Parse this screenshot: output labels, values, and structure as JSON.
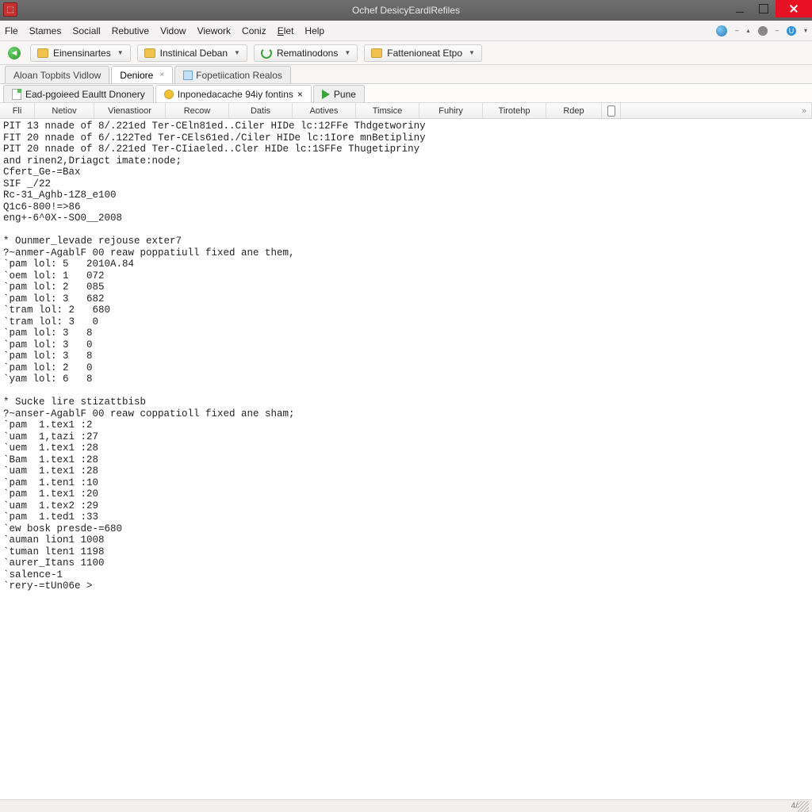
{
  "window": {
    "title": "Ochef DesicyEardlRefiles"
  },
  "menus": [
    "Fle",
    "Stames",
    "Sociall",
    "Rebutive",
    "Vidow",
    "Viework",
    "Coniz",
    "Elet",
    "Help"
  ],
  "menu_underline_idx": [
    -1,
    -1,
    -1,
    -1,
    -1,
    -1,
    -1,
    0,
    -1
  ],
  "toolbar": {
    "b1": "Einensinartes",
    "b2": "Instinical Deban",
    "b3": "Rematinodons",
    "b4": "Fattenioneat Etpo"
  },
  "filetabs": {
    "t1": "Aloan Topbits Vidlow",
    "t2": "Deniore",
    "t3": "Fopetiication Realos"
  },
  "subtabs": {
    "s1": "Ead-pgoieed Eaultt Dnonery",
    "s2": "Inponedacache 94iy fontins",
    "s3": "Pune"
  },
  "cols": {
    "c1": "Fli",
    "c2": "Netiov",
    "c3": "Vienastioor",
    "c4": "Recow",
    "c5": "Datis",
    "c6": "Aotives",
    "c7": "Timsice",
    "c8": "Fuhiry",
    "c9": "Tirotehp",
    "c10": "Rdep"
  },
  "output": "PIT 13 nnade of 8/.221ed Ter-CEln81ed..Ciler HIDe lc:12FFe Thdgetworiny\nFIT 20 nnade of 6/.122Ted Ter-CEls61ed./Ciler HIDe lc:1Iore mnBetipliny\nPIT 20 nnade of 8/.221ed Ter-CIiaeled..Cler HIDe lc:1SFFe Thugetipriny\nand rinen2,Driagct imate:node;\nCfert_Ge-=Bax\nSIF _/22\nRc-31_Aghb-1Z8_e100\nQ1c6-800!=>86\neng+-6^0X--SO0__2008\n\n* Ounmer_levade rejouse exter7\n?~anmer-AgablF 00 reaw poppatiull fixed ane them,\n`pam lol: 5   2010A.84\n`oem lol: 1   072\n`pam lol: 2   085\n`pam lol: 3   682\n`tram lol: 2   680\n`tram lol: 3   0\n`pam lol: 3   8\n`pam lol: 3   0\n`pam lol: 3   8\n`pam lol: 2   0\n`yam lol: 6   8\n\n* Sucke lire stizattbisb\n?~anser-AgablF 00 reaw coppatioll fixed ane sham;\n`pam  1.tex1 :2\n`uam  1,tazi :27\n`uem  1.tex1 :28\n`Bam  1.tex1 :28\n`uam  1.tex1 :28\n`pam  1.ten1 :10\n`pam  1.tex1 :20\n`uam  1.tex2 :29\n`pam  1.ted1 :33\n`ew bosk presde-=680\n`auman lion1 1008\n`tuman lten1 1198\n`aurer_Itans 1100\n`salence-1\n`rery-=tUn06e >",
  "status": "4/"
}
